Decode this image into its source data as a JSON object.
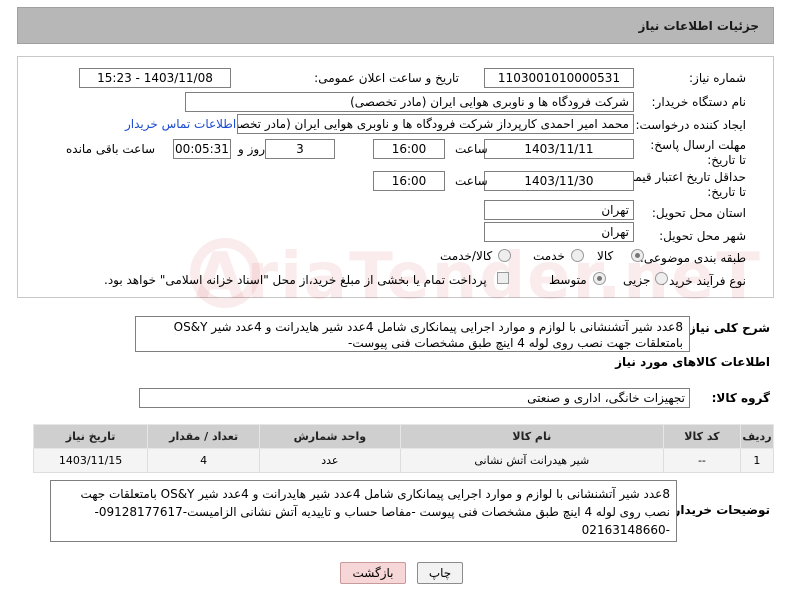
{
  "header": {
    "title": "جزئیات اطلاعات نیاز"
  },
  "form": {
    "need_number_label": "شماره نیاز:",
    "need_number": "1103001010000531",
    "announce_label": "تاریخ و ساعت اعلان عمومی:",
    "announce_value": "1403/11/08 - 15:23",
    "buyer_org_label": "نام دستگاه خریدار:",
    "buyer_org": "شرکت فرودگاه ها و ناوبری هوایی ایران (مادر تخصصی)",
    "creator_label": "ایجاد کننده درخواست:",
    "creator": "محمد امیر احمدی کارپرداز شرکت فرودگاه ها و ناوبری هوایی ایران (مادر تخصصی",
    "contact_link": "اطلاعات تماس خریدار",
    "deadline_label": "مهلت ارسال پاسخ: تا تاریخ:",
    "deadline_date": "1403/11/11",
    "time_word": "ساعت",
    "deadline_time": "16:00",
    "days_value": "3",
    "days_word": "روز و",
    "remaining_time": "00:05:31",
    "remaining_word": "ساعت باقی مانده",
    "validity_label": "حداقل تاریخ اعتبار قیمت: تا تاریخ:",
    "validity_date": "1403/11/30",
    "validity_time": "16:00",
    "province_label": "استان محل تحویل:",
    "province": "تهران",
    "city_label": "شهر محل تحویل:",
    "city": "تهران",
    "category_label": "طبقه بندی موضوعی:",
    "category_options": [
      "کالا",
      "خدمت",
      "کالا/خدمت"
    ],
    "purchase_type_label": "نوع فرآیند خرید :",
    "purchase_options": [
      "جزیی",
      "متوسط"
    ],
    "payment_note": "پرداخت تمام یا بخشی از مبلغ خرید،از محل \"اسناد خزانه اسلامی\" خواهد بود."
  },
  "summary": {
    "label": "شرح کلی نیاز:",
    "text": "8عدد شیر آتشنشانی با لوازم و موارد اجرایی پیمانکاری شامل 4عدد شیر هایدرانت و 4عدد شیر OS&Y بامتعلقات جهت نصب روی لوله 4 اینچ طبق مشخصات فنی پیوست-"
  },
  "goods": {
    "section_title": "اطلاعات کالاهای مورد نیاز",
    "group_label": "گروه کالا:",
    "group_value": "تجهیزات خانگی، اداری و صنعتی",
    "columns": [
      "ردیف",
      "کد کالا",
      "نام کالا",
      "واحد شمارش",
      "تعداد / مقدار",
      "تاریخ نیاز"
    ],
    "rows": [
      [
        "1",
        "--",
        "شیر هیدرانت آتش نشانی",
        "عدد",
        "4",
        "1403/11/15"
      ]
    ]
  },
  "buyer_notes": {
    "label": "توضیحات خریدار:",
    "text": "8عدد شیر آتشنشانی با لوازم و موارد اجرایی پیمانکاری شامل 4عدد شیر هایدرانت و 4عدد شیر OS&Y بامتعلقات جهت نصب روی لوله 4 اینچ طبق مشخصات فنی پیوست -مفاصا حساب و تاییدیه آتش نشانی الزامیست-09128177617--02163148660"
  },
  "buttons": {
    "print": "چاپ",
    "back": "بازگشت"
  },
  "watermark": "AriaTender.neT",
  "colors": {
    "header_bg": "#b7b7b7",
    "link": "#1a4bd1",
    "back_btn": "#f6d6d6"
  }
}
